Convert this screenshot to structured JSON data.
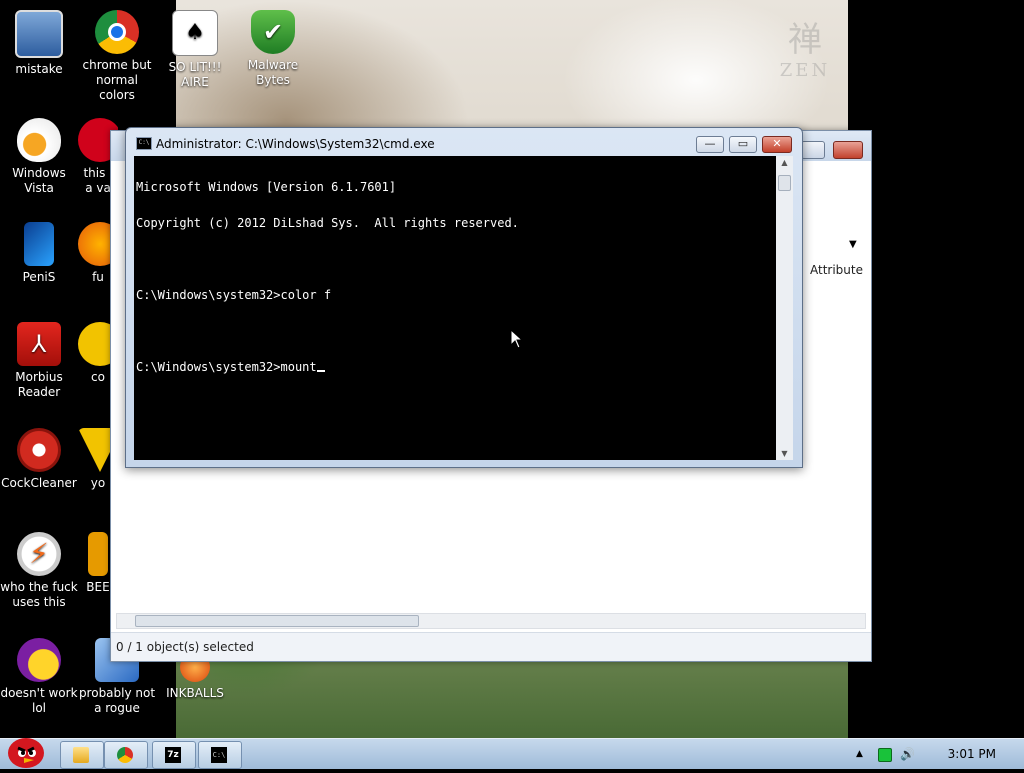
{
  "desktop": {
    "icons": [
      {
        "label": "mistake",
        "icon": "monitor-icon"
      },
      {
        "label": "chrome but normal colors",
        "icon": "chrome-icon"
      },
      {
        "label": "SO LIT!!! AIRE",
        "icon": "solitaire-icon"
      },
      {
        "label": "Malware Bytes",
        "icon": "shield-check-icon"
      },
      {
        "label": "Windows Vista",
        "icon": "egg-icon"
      },
      {
        "label": "this i a va",
        "icon": "opera-icon"
      },
      {
        "label": "PeniS",
        "icon": "blue-phone-icon"
      },
      {
        "label": "fu",
        "icon": "firefox-icon"
      },
      {
        "label": "Morbius Reader",
        "icon": "acrobat-icon"
      },
      {
        "label": "co",
        "icon": "yellow-icon"
      },
      {
        "label": "CockCleaner",
        "icon": "ccleaner-icon"
      },
      {
        "label": "yo",
        "icon": "yellow-icon"
      },
      {
        "label": "who the fuck uses this",
        "icon": "lightning-icon"
      },
      {
        "label": "BEE",
        "icon": "bee-icon"
      },
      {
        "label": "doesn't work lol",
        "icon": "yahoo-messenger-icon"
      },
      {
        "label": "probably not a rogue",
        "icon": "rogue-app-icon"
      },
      {
        "label": "INKBALLS",
        "icon": "inkball-icon"
      }
    ]
  },
  "explorer": {
    "column_header": "Attribute",
    "status": "0 / 1 object(s) selected"
  },
  "cmd": {
    "title": "Administrator: C:\\Windows\\System32\\cmd.exe",
    "lines": [
      "Microsoft Windows [Version 6.1.7601]",
      "Copyright (c) 2012 DiLshad Sys.  All rights reserved.",
      "",
      "C:\\Windows\\system32>color f",
      "",
      "C:\\Windows\\system32>mount"
    ],
    "minimize_symbol": "—",
    "maximize_symbol": "▭",
    "close_symbol": "✕"
  },
  "taskbar": {
    "clock": "3:01 PM",
    "buttons": [
      {
        "name": "explorer-taskbar-button",
        "icon": "folder-icon"
      },
      {
        "name": "chrome-taskbar-button",
        "icon": "chrome-icon"
      },
      {
        "name": "7zip-taskbar-button",
        "icon": "7zip-icon",
        "text": "7z"
      },
      {
        "name": "cmd-taskbar-button",
        "icon": "cmd-icon",
        "text": "C:\\"
      }
    ]
  }
}
